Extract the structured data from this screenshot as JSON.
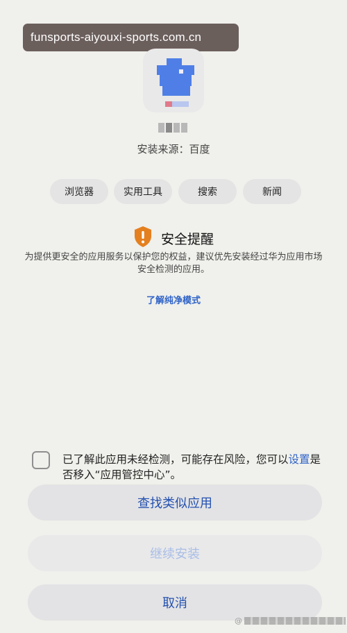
{
  "banner": {
    "url": "funsports-aiyouxi-sports.com.cn"
  },
  "app": {
    "source": "安装来源：百度",
    "tags": [
      "浏览器",
      "实用工具",
      "搜索",
      "新闻"
    ]
  },
  "warning": {
    "icon": "shield-alert-icon",
    "title": "安全提醒",
    "text": "为提供更安全的应用服务以保护您的权益，建议优先安装经过华为应用市场安全检测的应用。",
    "link": "了解纯净模式"
  },
  "consent": {
    "checked": false,
    "text_prefix": "已了解此应用未经检测，可能存在风险，您可以",
    "text_link": "设置",
    "text_suffix": "是否移入“应用管控中心”。"
  },
  "buttons": {
    "find_similar": "查找类似应用",
    "continue_install": "继续安装",
    "cancel": "取消"
  },
  "watermark": {
    "prefix": "@"
  },
  "colors": {
    "accent": "#2451b0",
    "link": "#2f63c7",
    "warning_orange": "#e4801f",
    "background": "#f0f0ec",
    "button_bg": "#e3e3e5"
  }
}
